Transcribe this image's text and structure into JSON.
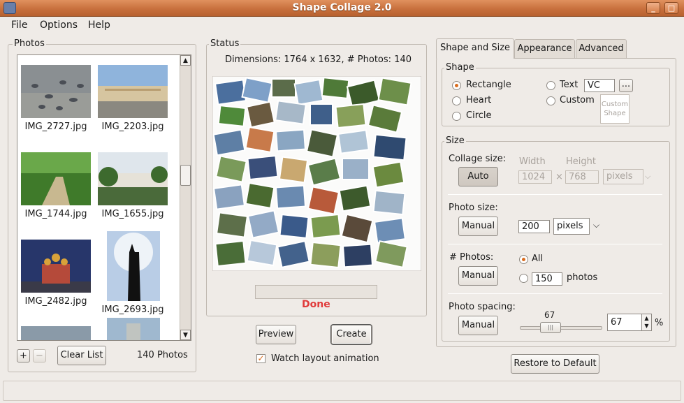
{
  "window": {
    "title": "Shape Collage 2.0",
    "min_glyph": "_",
    "max_glyph": "□",
    "close_glyph": "✕"
  },
  "menu": {
    "file": "File",
    "options": "Options",
    "help": "Help"
  },
  "photos_panel": {
    "title": "Photos",
    "items": [
      {
        "name": "IMG_2727.jpg"
      },
      {
        "name": "IMG_2203.jpg"
      },
      {
        "name": "IMG_1744.jpg"
      },
      {
        "name": "IMG_1655.jpg"
      },
      {
        "name": "IMG_2482.jpg"
      },
      {
        "name": "IMG_2693.jpg"
      }
    ],
    "add_label": "+",
    "remove_label": "−",
    "clear_label": "Clear List",
    "count_label": "140 Photos"
  },
  "status_panel": {
    "title": "Status",
    "dimensions": "Dimensions: 1764 x 1632, # Photos: 140",
    "progress": 0,
    "done_label": "Done",
    "preview_label": "Preview",
    "create_label": "Create",
    "watch_label": "Watch layout animation",
    "watch_checked": true
  },
  "tabs": {
    "shape_size": "Shape and Size",
    "appearance": "Appearance",
    "advanced": "Advanced"
  },
  "shape_group": {
    "title": "Shape",
    "rectangle": "Rectangle",
    "heart": "Heart",
    "circle": "Circle",
    "text": "Text",
    "text_value": "VC",
    "ellipsis": "...",
    "custom": "Custom",
    "custom_shape_line1": "Custom",
    "custom_shape_line2": "Shape",
    "selected": "Rectangle"
  },
  "size_group": {
    "title": "Size",
    "collage_size_label": "Collage size:",
    "auto_label": "Auto",
    "width_label": "Width",
    "height_label": "Height",
    "width_value": "1024",
    "height_value": "768",
    "times": "×",
    "unit_value": "pixels",
    "photo_size_label": "Photo size:",
    "manual_label": "Manual",
    "photo_size_value": "200",
    "photo_unit_value": "pixels",
    "num_photos_label": "# Photos:",
    "all_label": "All",
    "count_value": "150",
    "photos_suffix": "photos",
    "spacing_label": "Photo spacing:",
    "spacing_slider_value": "67",
    "spacing_value": "67",
    "percent": "%"
  },
  "restore_label": "Restore to Default",
  "colors": {
    "accent": "#d96c1e",
    "done": "#e03a3a",
    "titlebar": "#c8703d"
  }
}
